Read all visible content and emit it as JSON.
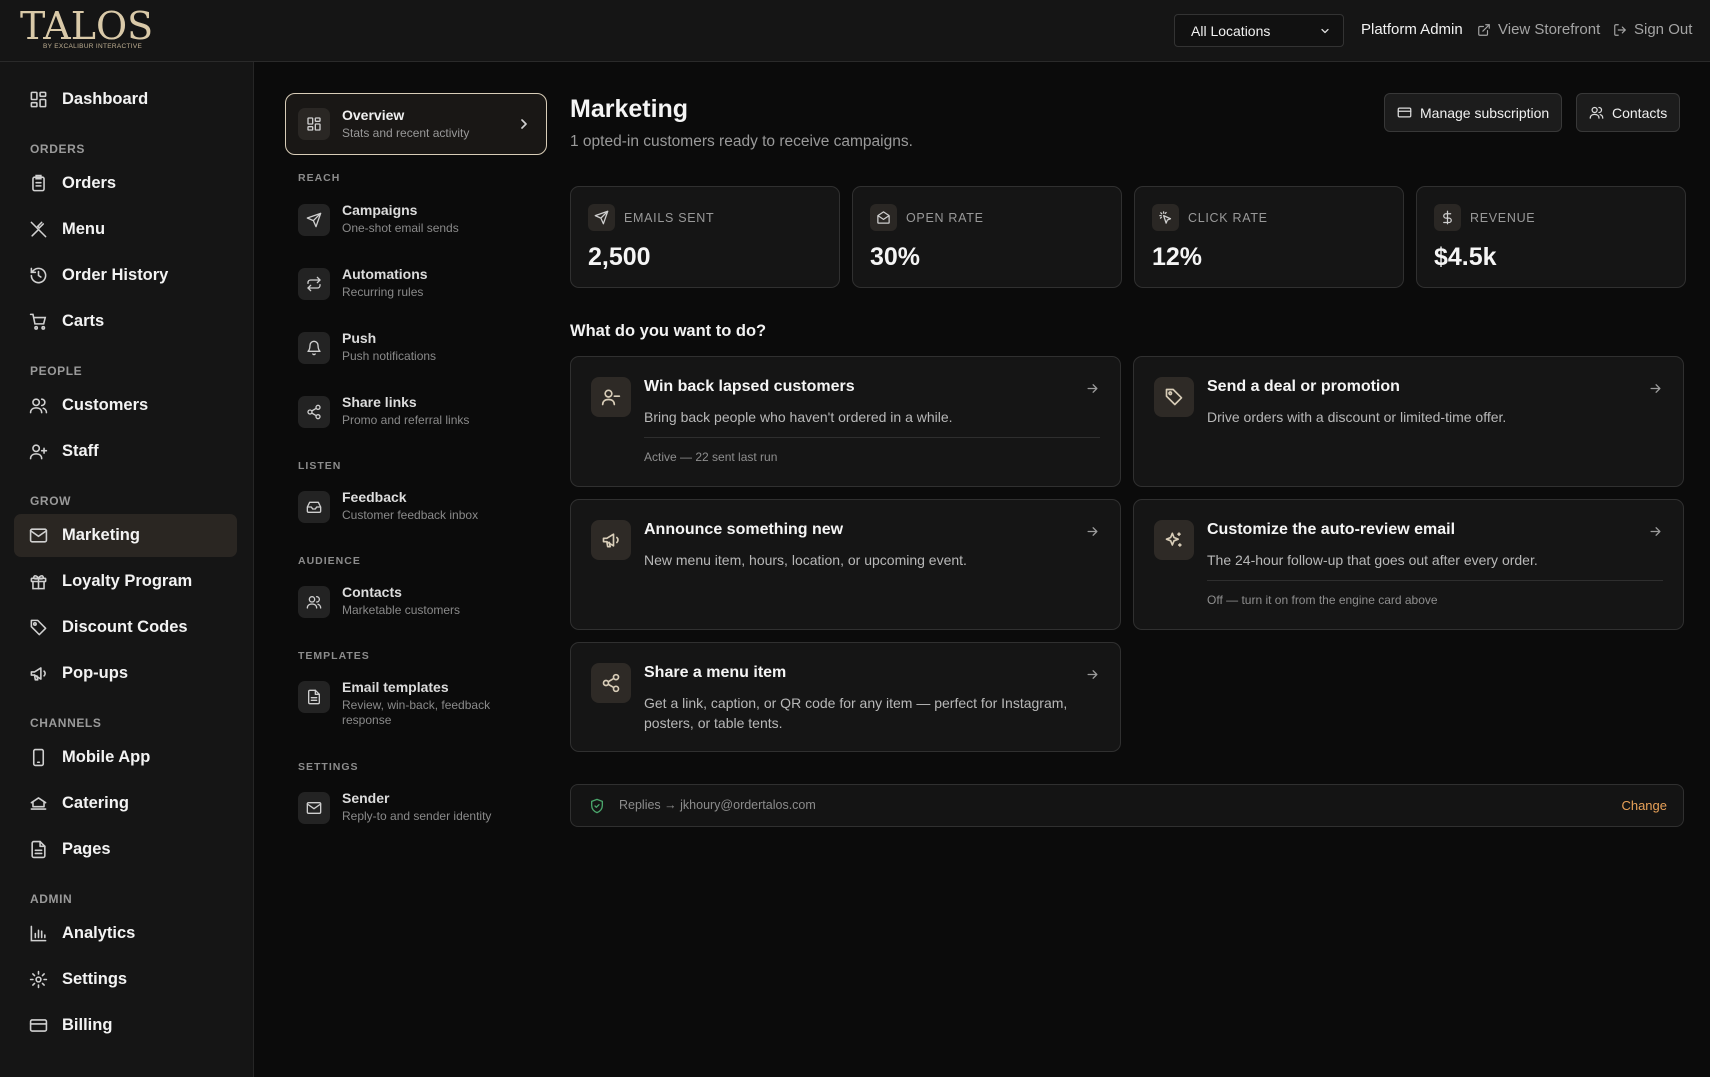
{
  "header": {
    "logo_main": "TALOS",
    "logo_sub": "BY EXCALIBUR INTERACTIVE",
    "location_selected": "All Locations",
    "admin_label": "Platform Admin",
    "storefront_label": "View Storefront",
    "signout_label": "Sign Out"
  },
  "sidebar": {
    "dashboard": "Dashboard",
    "sections": {
      "orders": "ORDERS",
      "people": "PEOPLE",
      "grow": "GROW",
      "channels": "CHANNELS",
      "admin": "ADMIN"
    },
    "items": {
      "orders": "Orders",
      "menu": "Menu",
      "order_history": "Order History",
      "carts": "Carts",
      "customers": "Customers",
      "staff": "Staff",
      "marketing": "Marketing",
      "loyalty": "Loyalty Program",
      "discount_codes": "Discount Codes",
      "popups": "Pop-ups",
      "mobile_app": "Mobile App",
      "catering": "Catering",
      "pages": "Pages",
      "analytics": "Analytics",
      "settings": "Settings",
      "billing": "Billing"
    }
  },
  "subnav": {
    "overview": {
      "title": "Overview",
      "desc": "Stats and recent activity"
    },
    "sections": {
      "reach": "REACH",
      "listen": "LISTEN",
      "audience": "AUDIENCE",
      "templates": "TEMPLATES",
      "settings": "SETTINGS"
    },
    "campaigns": {
      "title": "Campaigns",
      "desc": "One-shot email sends"
    },
    "automations": {
      "title": "Automations",
      "desc": "Recurring rules"
    },
    "push": {
      "title": "Push",
      "desc": "Push notifications"
    },
    "share_links": {
      "title": "Share links",
      "desc": "Promo and referral links"
    },
    "feedback": {
      "title": "Feedback",
      "desc": "Customer feedback inbox"
    },
    "contacts": {
      "title": "Contacts",
      "desc": "Marketable customers"
    },
    "email_templates": {
      "title": "Email templates",
      "desc": "Review, win-back, feedback response"
    },
    "sender": {
      "title": "Sender",
      "desc": "Reply-to and sender identity"
    }
  },
  "main": {
    "title": "Marketing",
    "subtitle": "1 opted-in customers ready to receive campaigns.",
    "manage_subscription": "Manage subscription",
    "contacts_button": "Contacts",
    "stats": {
      "emails_sent": {
        "label": "EMAILS SENT",
        "value": "2,500"
      },
      "open_rate": {
        "label": "OPEN RATE",
        "value": "30%"
      },
      "click_rate": {
        "label": "CLICK RATE",
        "value": "12%"
      },
      "revenue": {
        "label": "REVENUE",
        "value": "$4.5k"
      }
    },
    "actions_heading": "What do you want to do?",
    "cards": {
      "winback": {
        "title": "Win back lapsed customers",
        "desc": "Bring back people who haven't ordered in a while.",
        "status": "Active — 22 sent last run"
      },
      "deal": {
        "title": "Send a deal or promotion",
        "desc": "Drive orders with a discount or limited-time offer."
      },
      "announce": {
        "title": "Announce something new",
        "desc": "New menu item, hours, location, or upcoming event."
      },
      "autoreview": {
        "title": "Customize the auto-review email",
        "desc": "The 24-hour follow-up that goes out after every order.",
        "status": "Off — turn it on from the engine card above"
      },
      "share_item": {
        "title": "Share a menu item",
        "desc": "Get a link, caption, or QR code for any item — perfect for Instagram, posters, or table tents."
      }
    },
    "reply": {
      "text": "Replies → jkhoury@ordertalos.com",
      "change": "Change"
    }
  },
  "colors": {
    "accent": "#e8a158",
    "active_bg": "#2a2622",
    "shield": "#4aa56b"
  }
}
